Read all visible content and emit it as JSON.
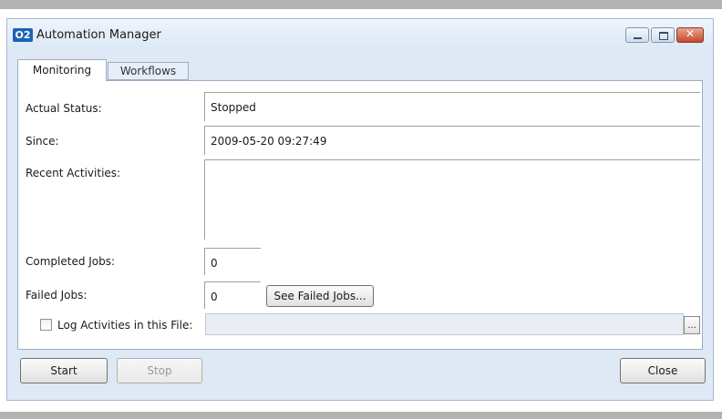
{
  "window": {
    "app_logo": "O2",
    "title": "Automation Manager"
  },
  "tabs": [
    {
      "label": "Monitoring",
      "active": true
    },
    {
      "label": "Workflows",
      "active": false
    }
  ],
  "monitoring": {
    "actual_status_label": "Actual Status:",
    "actual_status_value": "Stopped",
    "since_label": "Since:",
    "since_value": "2009-05-20 09:27:49",
    "recent_activities_label": "Recent Activities:",
    "recent_activities_value": "",
    "completed_jobs_label": "Completed Jobs:",
    "completed_jobs_value": "0",
    "failed_jobs_label": "Failed Jobs:",
    "failed_jobs_value": "0",
    "see_failed_jobs_label": "See Failed Jobs...",
    "log_activities_label": "Log Activities in this File:",
    "log_activities_checked": false,
    "log_file_value": "",
    "browse_label": "..."
  },
  "footer": {
    "start_label": "Start",
    "stop_label": "Stop",
    "close_label": "Close"
  }
}
